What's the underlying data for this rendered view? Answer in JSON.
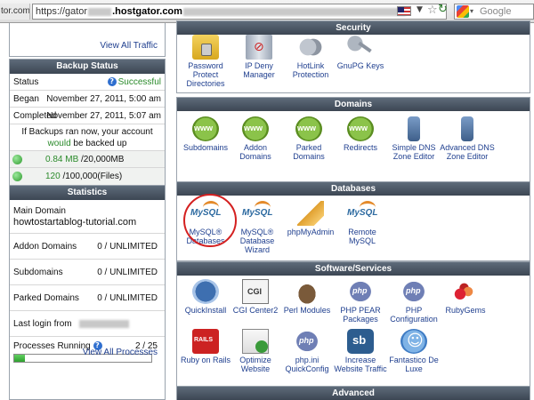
{
  "browser": {
    "url_tail_text": "tor.com",
    "url_prefix": "https://gator",
    "url_host": ".hostgator.com",
    "search_placeholder": "Google"
  },
  "sidebar": {
    "top_link": "View All Traffic",
    "backup": {
      "title": "Backup Status",
      "status_label": "Status",
      "status_value": "Successful",
      "began_label": "Began",
      "began_value": "November 27, 2011, 5:00 am",
      "completed_label": "Completed",
      "completed_value": "November 27, 2011, 5:07 am",
      "note_line1": "If Backups ran now, your account",
      "note_would": "would",
      "note_line2_rest": " be backed up",
      "size_used": "0.84 MB",
      "size_limit": " /20,000MB",
      "files_used": "120",
      "files_limit": " /100,000(Files)"
    },
    "stats": {
      "title": "Statistics",
      "main_domain_label": "Main Domain",
      "main_domain_value": "howtostartablog-tutorial.com",
      "addon_label": "Addon Domains",
      "addon_value": "0 / UNLIMITED",
      "sub_label": "Subdomains",
      "sub_value": "0 / UNLIMITED",
      "parked_label": "Parked Domains",
      "parked_value": "0 / UNLIMITED",
      "login_label": "Last login from",
      "processes_label": "Processes Running",
      "processes_value": "2 / 25",
      "processes_running": 2,
      "processes_max": 25,
      "processes_link": "View All Processes"
    }
  },
  "sections": {
    "security": {
      "title": "Security",
      "items": [
        {
          "label": "Password Protect Directories",
          "icon": "folder-lock-icon"
        },
        {
          "label": "IP Deny Manager",
          "icon": "server-deny-icon"
        },
        {
          "label": "HotLink Protection",
          "icon": "chain-icon"
        },
        {
          "label": "GnuPG Keys",
          "icon": "keys-icon"
        }
      ]
    },
    "domains": {
      "title": "Domains",
      "items": [
        {
          "label": "Subdomains",
          "icon": "www-icon"
        },
        {
          "label": "Addon Domains",
          "icon": "www-icon"
        },
        {
          "label": "Parked Domains",
          "icon": "www-icon"
        },
        {
          "label": "Redirects",
          "icon": "www-icon"
        },
        {
          "label": "Simple DNS Zone Editor",
          "icon": "network-icon"
        },
        {
          "label": "Advanced DNS Zone Editor",
          "icon": "network-icon"
        }
      ]
    },
    "databases": {
      "title": "Databases",
      "items": [
        {
          "label": "MySQL® Databases",
          "icon": "mysql-icon"
        },
        {
          "label": "MySQL® Database Wizard",
          "icon": "mysql-wizard-icon"
        },
        {
          "label": "phpMyAdmin",
          "icon": "phpmyadmin-icon"
        },
        {
          "label": "Remote MySQL",
          "icon": "remote-mysql-icon"
        }
      ]
    },
    "software": {
      "title": "Software/Services",
      "items": [
        {
          "label": "QuickInstall",
          "icon": "quickinstall-icon"
        },
        {
          "label": "CGI Center2",
          "icon": "cgi-icon"
        },
        {
          "label": "Perl Modules",
          "icon": "camel-icon"
        },
        {
          "label": "PHP PEAR Packages",
          "icon": "php-icon"
        },
        {
          "label": "PHP Configuration",
          "icon": "php-icon"
        },
        {
          "label": "RubyGems",
          "icon": "rubygems-icon"
        },
        {
          "label": "Ruby on Rails",
          "icon": "rails-icon"
        },
        {
          "label": "Optimize Website",
          "icon": "optimize-icon"
        },
        {
          "label": "php.ini QuickConfig",
          "icon": "php-icon"
        },
        {
          "label": "Increase Website Traffic",
          "icon": "sb-icon"
        },
        {
          "label": "Fantastico De Luxe",
          "icon": "smiley-icon"
        }
      ]
    },
    "advanced": {
      "title": "Advanced"
    }
  },
  "colors": {
    "link": "#1f3f8f",
    "success": "#2a8a2a",
    "header": "#3c4653",
    "highlight": "#d42020"
  }
}
